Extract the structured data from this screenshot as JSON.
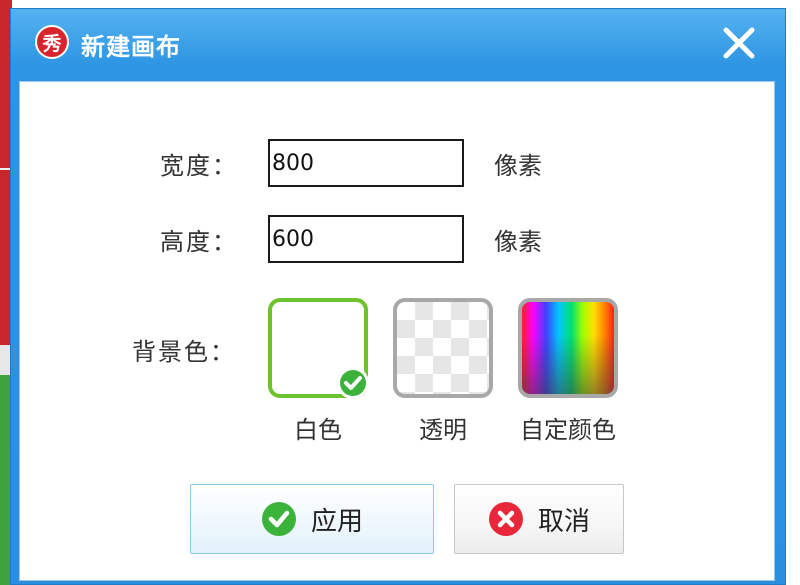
{
  "window": {
    "title": "新建画布",
    "logo_text": "秀"
  },
  "form": {
    "width_label": "宽度：",
    "width_value": "800",
    "width_unit": "像素",
    "height_label": "高度：",
    "height_value": "600",
    "height_unit": "像素",
    "background_label": "背景色："
  },
  "background_options": [
    {
      "label": "白色",
      "selected": true
    },
    {
      "label": "透明",
      "selected": false
    },
    {
      "label": "自定颜色",
      "selected": false
    }
  ],
  "buttons": {
    "apply_label": "应用",
    "cancel_label": "取消"
  },
  "colors": {
    "titlebar": "#2d95e3",
    "selected_border": "#6ec22c",
    "apply_icon": "#3bb33b",
    "cancel_icon": "#e8283a",
    "logo": "#d8242c"
  },
  "icons": {
    "logo": "app-logo-icon",
    "close": "close-icon",
    "selected": "check-badge-icon",
    "apply": "check-circle-icon",
    "cancel": "x-circle-icon"
  }
}
